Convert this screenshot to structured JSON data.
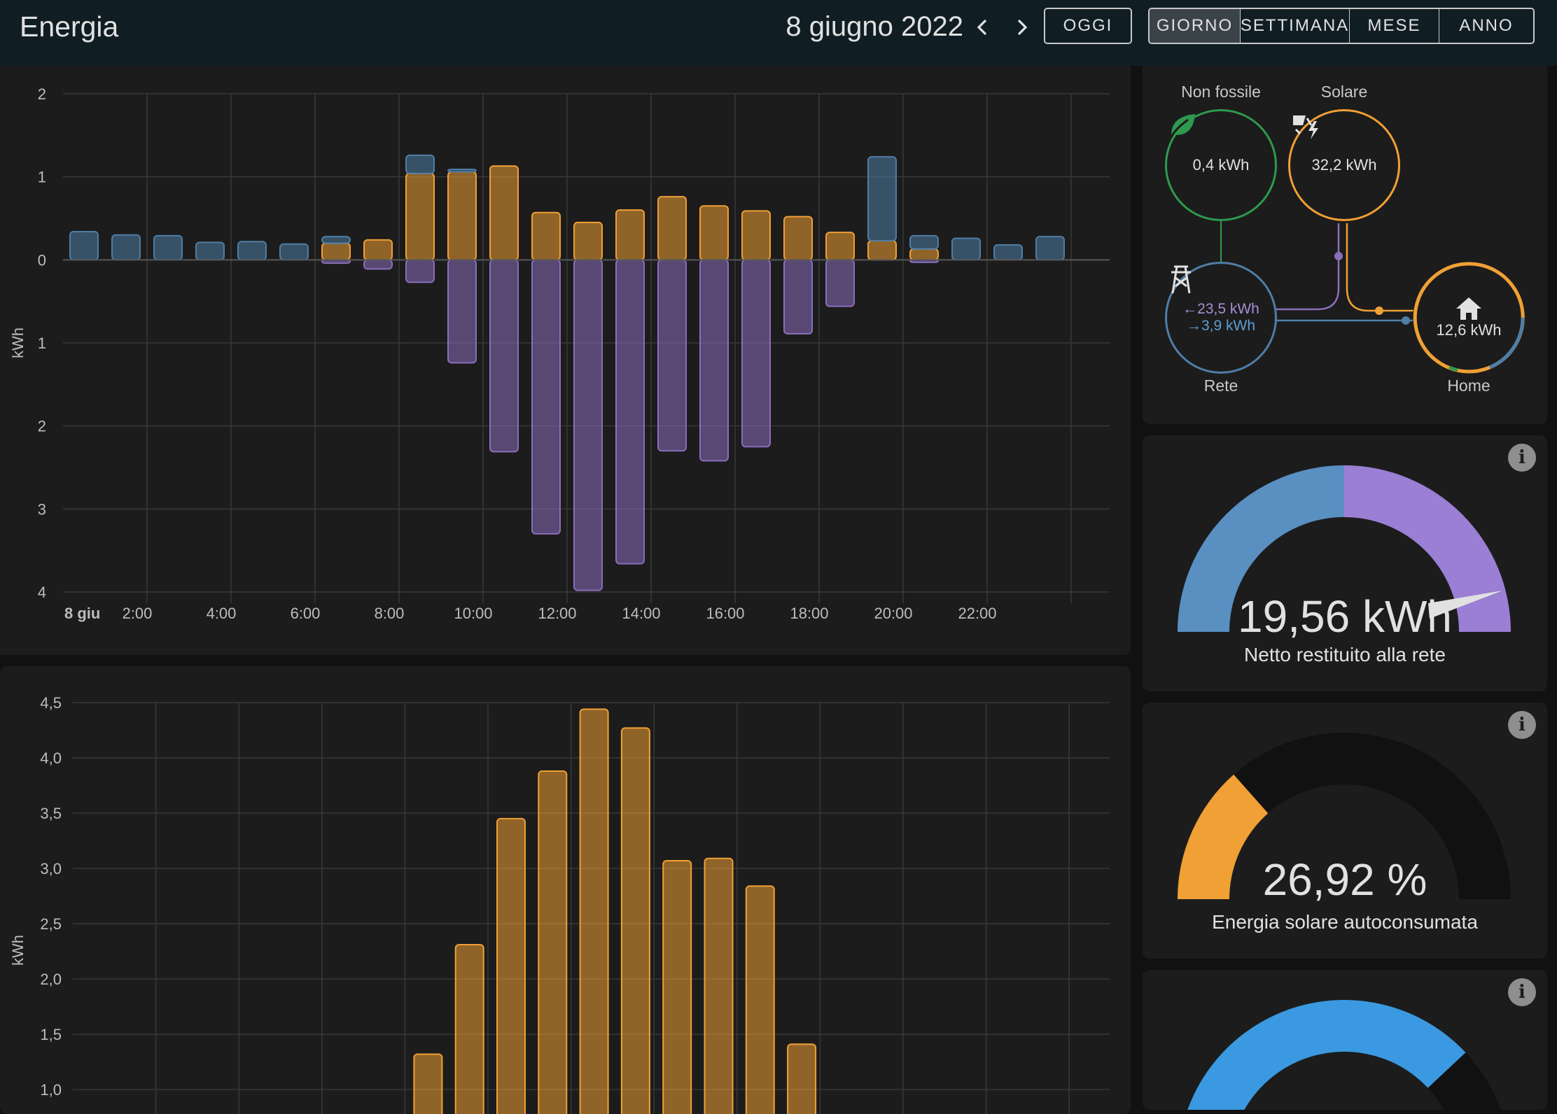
{
  "header": {
    "title": "Energia",
    "date": "8 giugno 2022",
    "today_label": "OGGI",
    "periods": [
      "GIORNO",
      "SETTIMANA",
      "MESE",
      "ANNO"
    ],
    "active_period": "GIORNO",
    "icons": [
      "chevron-left-icon",
      "chevron-right-icon"
    ]
  },
  "colors": {
    "grid_import": "#4f7ea6",
    "solar": "#f0a034",
    "grid_export": "#8a6dbc",
    "non_fossil": "#2e9a4f",
    "water": "#3a99e0",
    "background": "#1c1c1c"
  },
  "chart_data": [
    {
      "type": "bar",
      "ylabel": "kWh",
      "y_ticks": [
        "2",
        "1",
        "0",
        "1",
        "2",
        "3",
        "4"
      ],
      "ylim": [
        -4,
        2
      ],
      "x_tick_labels": [
        "8 giu",
        "2:00",
        "4:00",
        "6:00",
        "8:00",
        "10:00",
        "12:00",
        "14:00",
        "16:00",
        "18:00",
        "20:00",
        "22:00"
      ],
      "categories": [
        "0",
        "1",
        "2",
        "3",
        "4",
        "5",
        "6",
        "7",
        "8",
        "9",
        "10",
        "11",
        "12",
        "13",
        "14",
        "15",
        "16",
        "17",
        "18",
        "19",
        "20",
        "21",
        "22",
        "23"
      ],
      "series": [
        {
          "role": "solar",
          "values": [
            0,
            0,
            0,
            0,
            0,
            0,
            0.2,
            0.24,
            1.04,
            1.06,
            1.13,
            0.57,
            0.45,
            0.6,
            0.76,
            0.65,
            0.59,
            0.52,
            0.33,
            0.23,
            0.13,
            0,
            0,
            0
          ]
        },
        {
          "role": "grid-import",
          "values": [
            0.34,
            0.3,
            0.29,
            0.21,
            0.22,
            0.19,
            0.08,
            0,
            0.22,
            0.03,
            0,
            0,
            0,
            0,
            0,
            0,
            0,
            0,
            0,
            1.01,
            0.16,
            0.26,
            0.18,
            0.28
          ]
        },
        {
          "role": "grid-export",
          "values": [
            0,
            0,
            0,
            0,
            0,
            0,
            -0.04,
            -0.11,
            -0.27,
            -1.24,
            -2.31,
            -3.3,
            -3.98,
            -3.66,
            -2.3,
            -2.42,
            -2.25,
            -0.89,
            -0.56,
            0,
            -0.03,
            0,
            0,
            0
          ]
        }
      ]
    },
    {
      "type": "bar",
      "ylabel": "kWh",
      "y_ticks": [
        "4,5",
        "4,0",
        "3,5",
        "3,0",
        "2,5",
        "2,0",
        "1,5",
        "1,0"
      ],
      "ylim": [
        1.0,
        4.5
      ],
      "categories": [
        "0",
        "1",
        "2",
        "3",
        "4",
        "5",
        "6",
        "7",
        "8",
        "9",
        "10",
        "11",
        "12",
        "13",
        "14",
        "15",
        "16",
        "17",
        "18",
        "19",
        "20",
        "21",
        "22",
        "23"
      ],
      "series": [
        {
          "role": "solar",
          "values": [
            0,
            0,
            0,
            0,
            0,
            0,
            0,
            0,
            1.32,
            2.31,
            3.45,
            3.88,
            4.44,
            4.27,
            3.07,
            3.09,
            2.84,
            1.41,
            0,
            0,
            0,
            0,
            0,
            0
          ]
        }
      ]
    }
  ],
  "energy_flow": {
    "non_fossil": {
      "label": "Non fossile",
      "value": "0,4 kWh"
    },
    "solar": {
      "label": "Solare",
      "value": "32,2 kWh"
    },
    "grid": {
      "label": "Rete",
      "import_value": "←23,5 kWh",
      "export_value": "→3,9 kWh"
    },
    "home": {
      "label": "Home",
      "value": "12,6 kWh"
    }
  },
  "gauges": [
    {
      "value": "19,56 kWh",
      "label": "Netto restituito alla rete",
      "info": "i"
    },
    {
      "value": "26,92 %",
      "label": "Energia solare autoconsumata",
      "info": "i",
      "fraction": 0.2692
    },
    {
      "info": "i",
      "fraction": 0.76
    }
  ]
}
